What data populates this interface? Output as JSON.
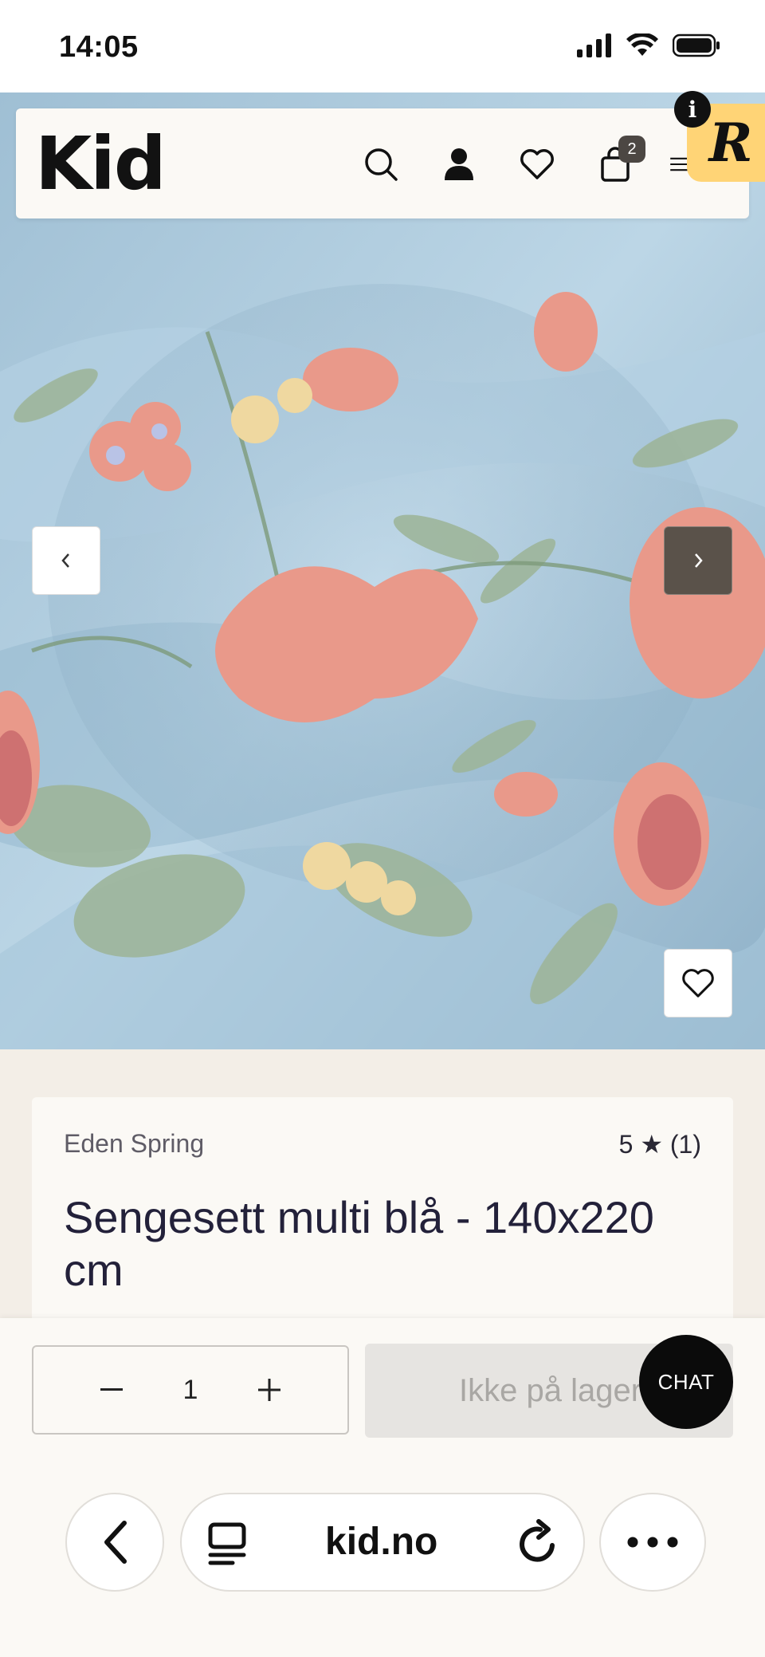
{
  "status": {
    "time": "14:05"
  },
  "header": {
    "logo": "Kid",
    "cart_count": "2",
    "icons": [
      "search-icon",
      "user-icon",
      "heart-icon",
      "bag-icon",
      "menu-icon"
    ]
  },
  "overlay": {
    "badge_letter": "R",
    "info_letter": "i"
  },
  "gallery": {
    "prev_glyph": "‹",
    "next_glyph": "›"
  },
  "product": {
    "brand": "Eden Spring",
    "rating": "5 ★ (1)",
    "title": "Sengesett multi blå - 140x220 cm"
  },
  "purchase": {
    "quantity": "1",
    "minus": "−",
    "plus": "+",
    "stock_label": "Ikke på lager",
    "chat_label": "CHAT"
  },
  "browser": {
    "url": "kid.no"
  },
  "colors": {
    "page_bg": "#f3eee7",
    "card_bg": "#fbf9f5",
    "title_color": "#23213a",
    "badge_yellow": "#ffd476",
    "arrow_dark": "#5a524a",
    "fabric_blue": "#a9c8dc",
    "flower_pink": "#e9998a"
  }
}
